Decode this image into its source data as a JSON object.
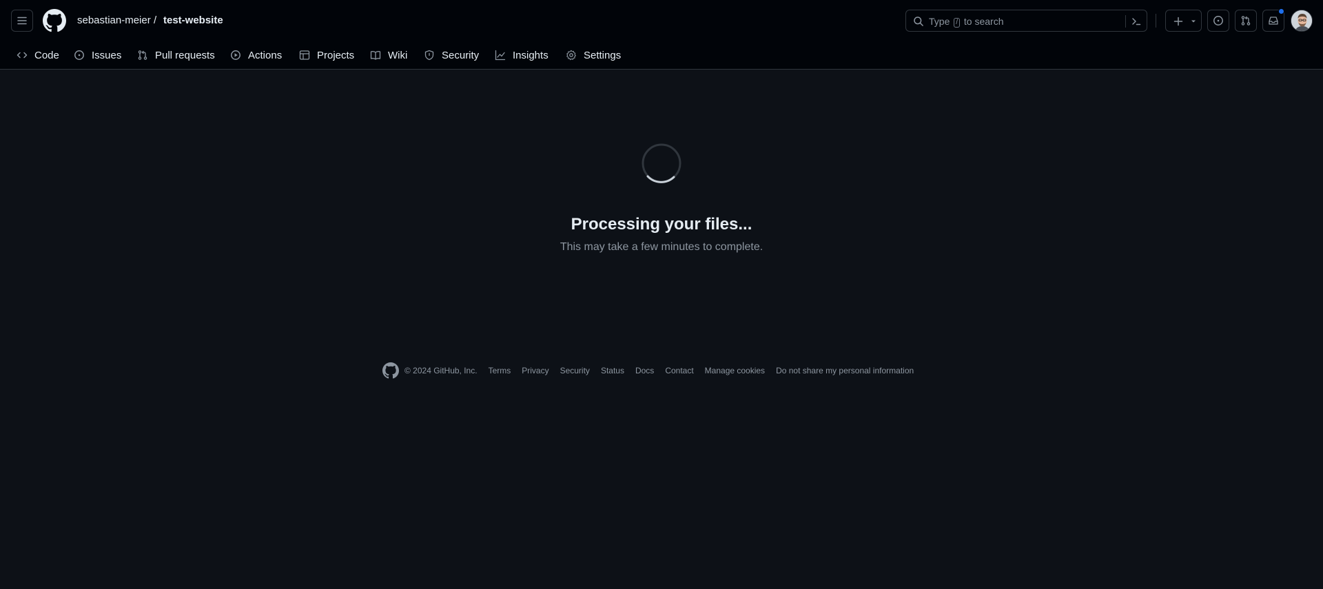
{
  "header": {
    "owner": "sebastian-meier",
    "separator": "/",
    "repo": "test-website",
    "search": {
      "before": "Type",
      "key": "/",
      "after": "to search"
    }
  },
  "tabs": [
    {
      "label": "Code",
      "icon": "code-icon"
    },
    {
      "label": "Issues",
      "icon": "issue-icon"
    },
    {
      "label": "Pull requests",
      "icon": "pull-request-icon"
    },
    {
      "label": "Actions",
      "icon": "play-icon"
    },
    {
      "label": "Projects",
      "icon": "table-icon"
    },
    {
      "label": "Wiki",
      "icon": "book-icon"
    },
    {
      "label": "Security",
      "icon": "shield-icon"
    },
    {
      "label": "Insights",
      "icon": "graph-icon"
    },
    {
      "label": "Settings",
      "icon": "gear-icon"
    }
  ],
  "main": {
    "title": "Processing your files...",
    "subtitle": "This may take a few minutes to complete."
  },
  "footer": {
    "copyright": "© 2024 GitHub, Inc.",
    "links": [
      "Terms",
      "Privacy",
      "Security",
      "Status",
      "Docs",
      "Contact",
      "Manage cookies",
      "Do not share my personal information"
    ]
  },
  "colors": {
    "header_bg": "#010409",
    "page_bg": "#0d1117",
    "border": "#30363d",
    "text": "#e6edf3",
    "muted": "#8d96a0",
    "accent": "#1f6feb"
  }
}
